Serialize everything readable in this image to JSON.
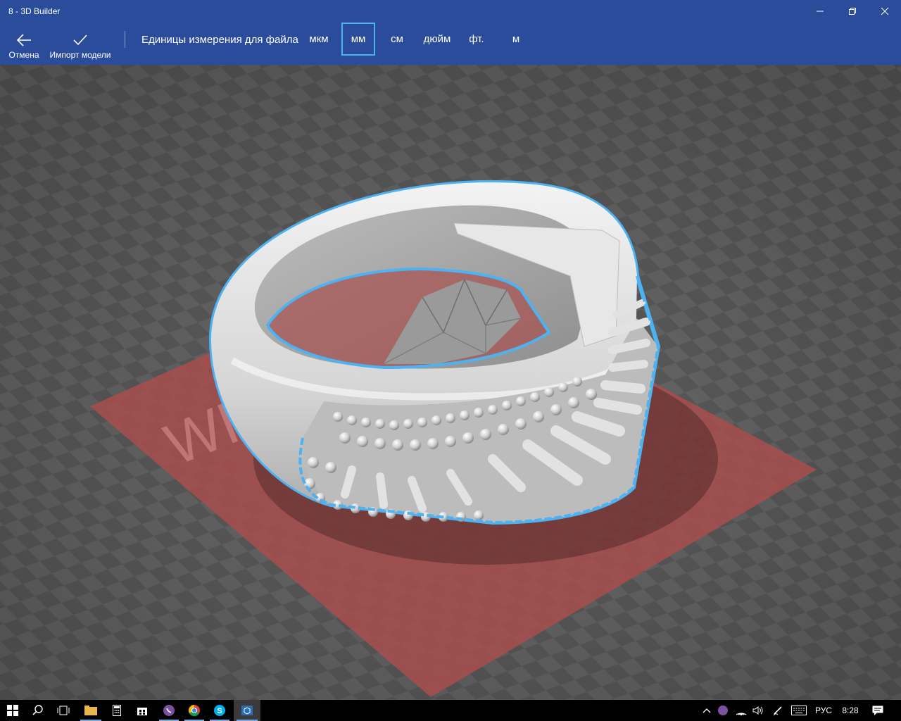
{
  "window": {
    "title": "8 - 3D Builder"
  },
  "toolbar": {
    "cancel_label": "Отмена",
    "import_label": "Импорт модели",
    "units_label": "Единицы измерения для файла",
    "units": [
      "мкм",
      "мм",
      "см",
      "дюйм",
      "фт.",
      "м"
    ],
    "selected_unit": "мм"
  },
  "viewport": {
    "watermark": "WI"
  },
  "taskbar": {
    "language": "РУС",
    "time": "8:28"
  },
  "colors": {
    "accent": "#2b4c9b",
    "selection": "#4cb2f2",
    "plate": "#a84e4e"
  }
}
